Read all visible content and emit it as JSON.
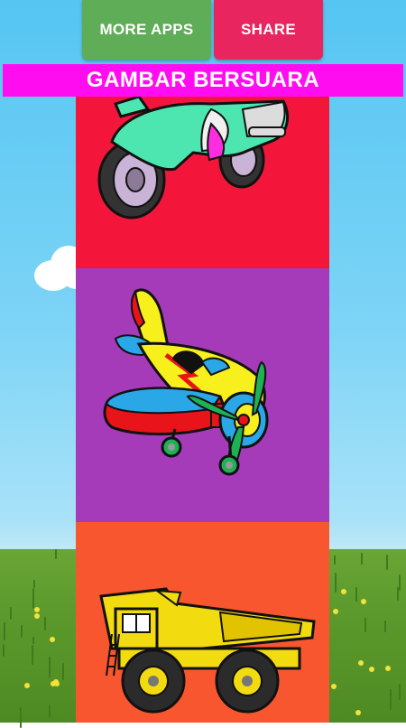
{
  "header": {
    "more_apps_label": "MORE APPS",
    "share_label": "SHARE"
  },
  "title": "GAMBAR BERSUARA",
  "tiles": [
    {
      "subject": "motorcycle",
      "background": "#f3163a"
    },
    {
      "subject": "airplane",
      "background": "#a53bb8"
    },
    {
      "subject": "dump-truck",
      "background": "#f7562e"
    }
  ],
  "colors": {
    "more_apps": "#5fad56",
    "share": "#e8255f",
    "title_bar": "#ff0df0",
    "sky": "#7dd4f6",
    "grass": "#5c9a2d"
  }
}
